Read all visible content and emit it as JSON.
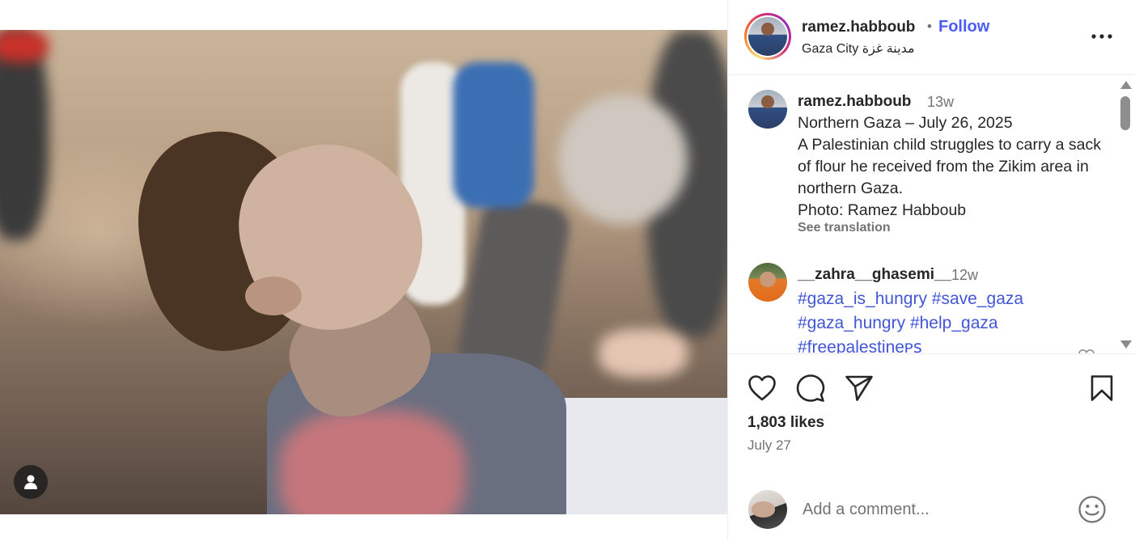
{
  "post": {
    "author": "ramez.habboub",
    "separator": "•",
    "follow_label": "Follow",
    "location": "Gaza City مدينة غزة"
  },
  "caption": {
    "username": "ramez.habboub",
    "time": "13w",
    "lines": [
      "Northern Gaza – July 26, 2025",
      "A Palestinian child struggles to carry a sack of flour he received from the Zikim area in northern Gaza.",
      "Photo: Ramez Habboub"
    ],
    "see_translation": "See translation"
  },
  "comments": [
    {
      "username": "__zahra__ghasemi__",
      "time": "12w",
      "hashtags": [
        "#gaza_is_hungry",
        "#save_gaza",
        "#gaza_hungry",
        "#help_gaza",
        "#freepalestineᴘꜱ"
      ]
    }
  ],
  "stats": {
    "likes": "1,803 likes",
    "date": "July 27"
  },
  "add_comment": {
    "placeholder": "Add a comment..."
  },
  "icons": {
    "like": "heart-icon",
    "comment": "comment-bubble-icon",
    "share": "paper-plane-icon",
    "save": "bookmark-icon",
    "more": "more-dots-icon",
    "user_tag": "user-tag-icon",
    "emoji": "emoji-smile-icon"
  },
  "colors": {
    "follow": "#4a5df9",
    "hashtag": "#4256d6",
    "muted": "#737373",
    "text": "#262626"
  }
}
